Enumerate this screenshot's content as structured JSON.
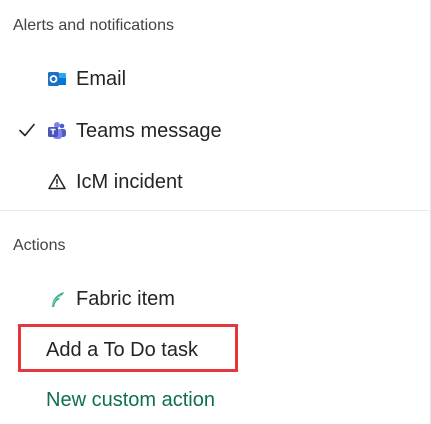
{
  "alerts_section": {
    "header": "Alerts and notifications",
    "items": [
      {
        "label": "Email",
        "icon": "outlook-icon",
        "checked": false
      },
      {
        "label": "Teams message",
        "icon": "teams-icon",
        "checked": true
      },
      {
        "label": "IcM incident",
        "icon": "warning-icon",
        "checked": false
      }
    ]
  },
  "actions_section": {
    "header": "Actions",
    "items": [
      {
        "label": "Fabric item",
        "icon": "fabric-icon"
      },
      {
        "label": "Add a To Do task"
      },
      {
        "label": "New custom action"
      }
    ]
  },
  "colors": {
    "highlight_border": "#e8343b",
    "link_text": "#0f6e56",
    "outlook_blue": "#1e6fc6",
    "teams_purple": "#5059c9"
  }
}
